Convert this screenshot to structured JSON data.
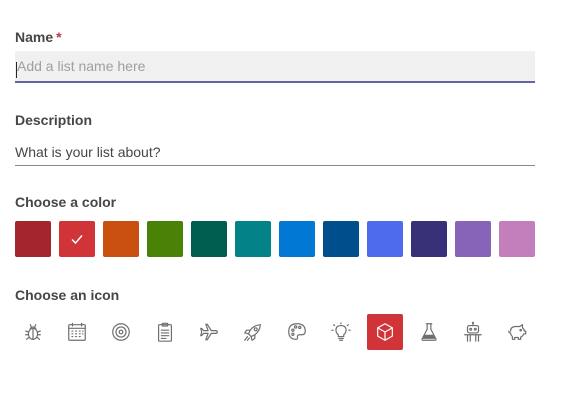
{
  "name": {
    "label": "Name",
    "required_mark": "*",
    "placeholder": "Add a list name here",
    "value": ""
  },
  "description": {
    "label": "Description",
    "placeholder": "What is your list about?",
    "value": ""
  },
  "color_section": {
    "label": "Choose a color",
    "selected_index": 1,
    "colors": [
      "#a4262c",
      "#d13438",
      "#ca5010",
      "#498205",
      "#005e50",
      "#038387",
      "#0078d4",
      "#004e8c",
      "#4f6bed",
      "#373277",
      "#8764b8",
      "#c27fbb"
    ]
  },
  "icon_section": {
    "label": "Choose an icon",
    "selected_index": 8,
    "icons": [
      "bug-icon",
      "calendar-icon",
      "target-icon",
      "clipboard-icon",
      "airplane-icon",
      "rocket-icon",
      "palette-icon",
      "lightbulb-icon",
      "cube-icon",
      "beaker-icon",
      "robot-icon",
      "piggy-bank-icon"
    ]
  }
}
